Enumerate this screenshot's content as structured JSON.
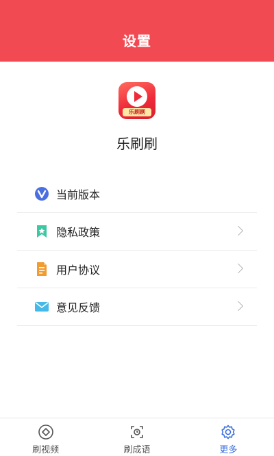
{
  "header": {
    "title": "设置"
  },
  "app": {
    "name": "乐刷刷",
    "icon_tag": "乐刷刷"
  },
  "menu": {
    "items": [
      {
        "label": "当前版本",
        "icon": "version-v-icon",
        "has_chevron": false
      },
      {
        "label": "隐私政策",
        "icon": "bookmark-icon",
        "has_chevron": true
      },
      {
        "label": "用户协议",
        "icon": "document-icon",
        "has_chevron": true
      },
      {
        "label": "意见反馈",
        "icon": "mail-icon",
        "has_chevron": true
      }
    ]
  },
  "tabbar": {
    "active_index": 2,
    "items": [
      {
        "label": "刷视频",
        "icon": "video-circle-icon"
      },
      {
        "label": "刷成语",
        "icon": "idiom-frame-icon"
      },
      {
        "label": "更多",
        "icon": "gear-icon"
      }
    ]
  },
  "colors": {
    "header_bg": "#f24a52",
    "active_tab": "#3a6fe0",
    "chevron": "#b5b5b5"
  }
}
